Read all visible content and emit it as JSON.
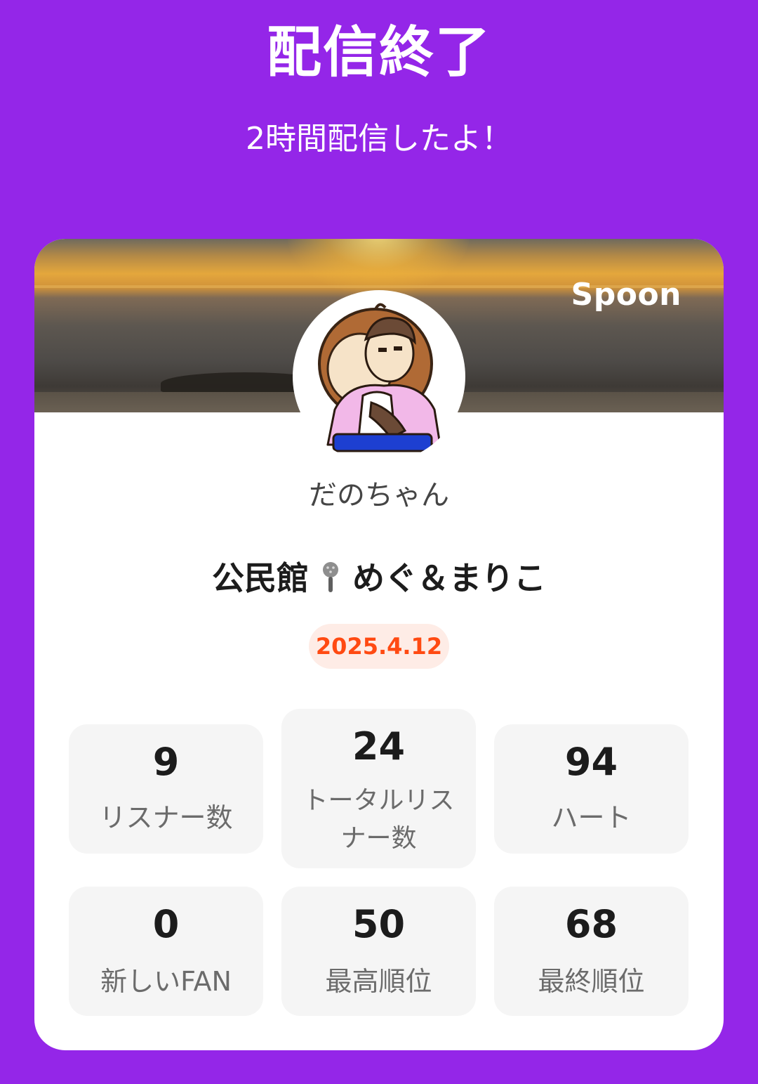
{
  "header": {
    "title": "配信終了",
    "subtitle": "2時間配信したよ！"
  },
  "card": {
    "brand": "Spoon",
    "username": "だのちゃん",
    "broadcast_title_left": "公民館",
    "broadcast_title_right": "めぐ＆まりこ",
    "date": "2025.4.12"
  },
  "stats": [
    {
      "value": "9",
      "label": "リスナー数"
    },
    {
      "value": "24",
      "label": "トータルリスナー数"
    },
    {
      "value": "94",
      "label": "ハート"
    },
    {
      "value": "0",
      "label": "新しいFAN"
    },
    {
      "value": "50",
      "label": "最高順位"
    },
    {
      "value": "68",
      "label": "最終順位"
    }
  ],
  "colors": {
    "background": "#9426E8",
    "accent": "#FF4A12",
    "badge_bg": "#FEECE6",
    "stat_bg": "#F5F5F5"
  },
  "icons": {
    "mic": "microphone-icon",
    "avatar": "avatar-illustration"
  }
}
